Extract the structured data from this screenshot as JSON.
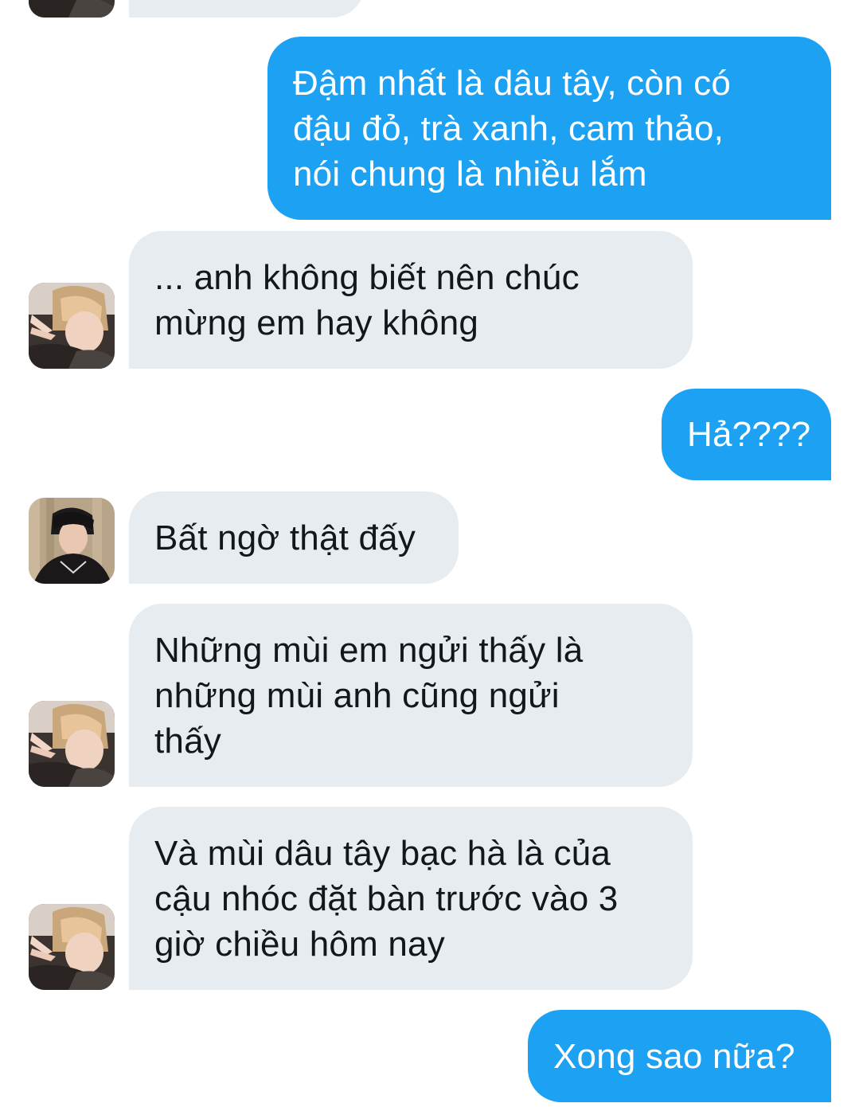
{
  "conversation": {
    "messages": [
      {
        "id": "m0",
        "side": "incoming",
        "text": "",
        "avatar": "avatar-blond"
      },
      {
        "id": "m1",
        "side": "outgoing",
        "text": "Đậm nhất là dâu tây, còn có\nđậu đỏ, trà xanh, cam thảo,\nnói chung là nhiều lắm"
      },
      {
        "id": "m2",
        "side": "incoming",
        "text": "... anh không biết nên chúc\nmừng em hay không",
        "avatar": "avatar-blond"
      },
      {
        "id": "m3",
        "side": "outgoing",
        "text": "Hả????"
      },
      {
        "id": "m4",
        "side": "incoming",
        "text": "Bất ngờ thật đấy",
        "avatar": "avatar-dark"
      },
      {
        "id": "m5",
        "side": "incoming",
        "text": "Những mùi em ngửi thấy là\nnhững mùi anh cũng ngửi\nthấy",
        "avatar": "avatar-blond"
      },
      {
        "id": "m6",
        "side": "incoming",
        "text": "Và mùi dâu tây bạc hà là của\ncậu nhóc đặt bàn trước vào 3\ngiờ chiều hôm nay",
        "avatar": "avatar-blond"
      },
      {
        "id": "m7",
        "side": "outgoing",
        "text": "Xong sao nữa?"
      }
    ]
  },
  "colors": {
    "outgoing_bubble": "#1da1f2",
    "incoming_bubble": "#e6ecf0",
    "incoming_text": "#14171a",
    "outgoing_text": "#ffffff"
  }
}
